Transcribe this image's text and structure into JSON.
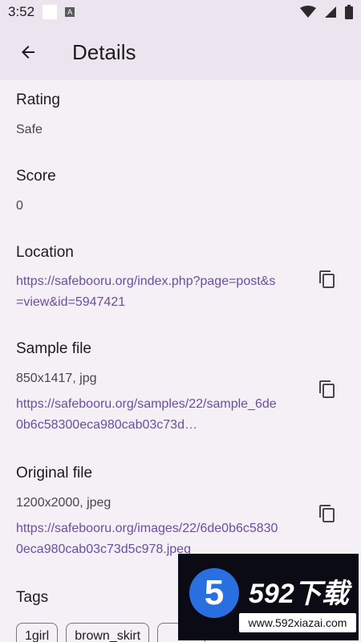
{
  "status_bar": {
    "time": "3:52",
    "badge": "A"
  },
  "app_bar": {
    "title": "Details"
  },
  "rating": {
    "label": "Rating",
    "value": "Safe"
  },
  "score": {
    "label": "Score",
    "value": "0"
  },
  "location": {
    "label": "Location",
    "url": "https://safebooru.org/index.php?page=post&s=view&id=5947421"
  },
  "sample_file": {
    "label": "Sample file",
    "info": "850x1417, jpg",
    "url": "https://safebooru.org/samples/22/sample_6de0b6c58300eca980cab03c73d…"
  },
  "original_file": {
    "label": "Original file",
    "info": "1200x2000, jpeg",
    "url": "https://safebooru.org/images/22/6de0b6c58300eca980cab03c73d5c978.jpeg"
  },
  "tags": {
    "label": "Tags",
    "items": [
      "1girl",
      "brown_skirt"
    ]
  },
  "watermark": {
    "brand": "592下载",
    "url": "www.592xiazai.com",
    "digit": "5"
  }
}
